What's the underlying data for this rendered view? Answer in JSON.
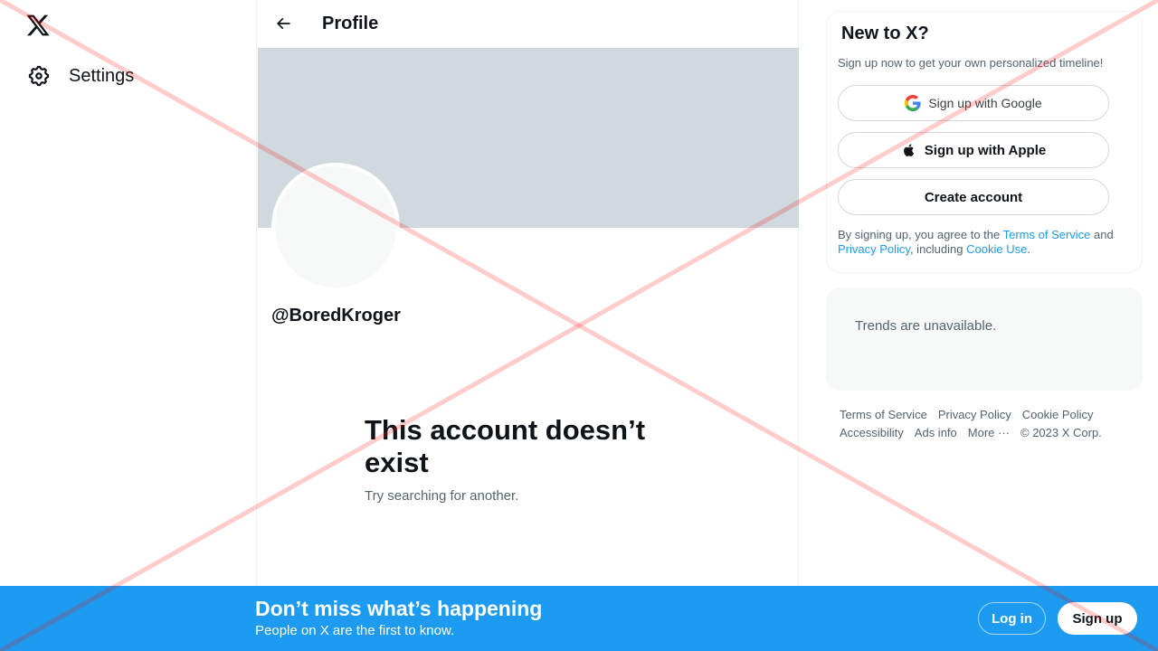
{
  "nav": {
    "settings_label": "Settings"
  },
  "header": {
    "title": "Profile"
  },
  "profile": {
    "handle": "@BoredKroger",
    "empty_title": "This account doesn’t exist",
    "empty_subtitle": "Try searching for another."
  },
  "signup_card": {
    "title": "New to X?",
    "subtitle": "Sign up now to get your own personalized timeline!",
    "google_label": "Sign up with Google",
    "apple_label": "Sign up with Apple",
    "create_label": "Create account",
    "legal": {
      "prefix": "By signing up, you agree to the ",
      "terms": "Terms of Service",
      "and": " and ",
      "privacy": "Privacy Policy",
      "including": ", including ",
      "cookie": "Cookie Use",
      "suffix": "."
    }
  },
  "trends": {
    "message": "Trends are unavailable."
  },
  "footer": {
    "terms": "Terms of Service",
    "privacy": "Privacy Policy",
    "cookie": "Cookie Policy",
    "accessibility": "Accessibility",
    "ads": "Ads info",
    "more": "More ···",
    "copyright": "© 2023 X Corp."
  },
  "bottom_bar": {
    "title": "Don’t miss what’s happening",
    "subtitle": "People on X are the first to know.",
    "login_label": "Log in",
    "signup_label": "Sign up"
  },
  "colors": {
    "accent": "#1d9bf0",
    "banner": "#cfd9de",
    "overlay_x": "#ff0000"
  }
}
